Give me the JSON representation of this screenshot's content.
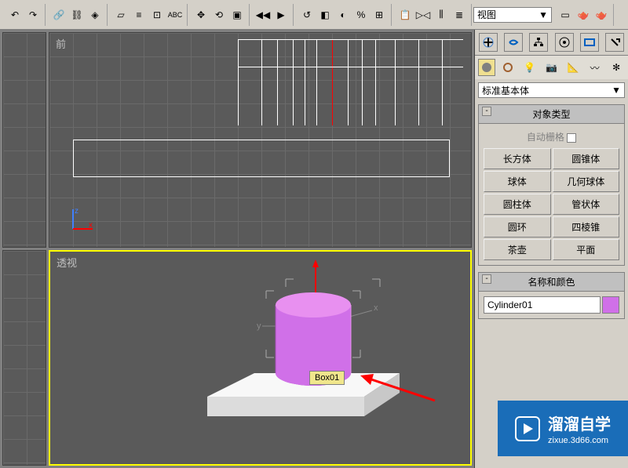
{
  "toolbar": {
    "view_dropdown": "视图"
  },
  "viewports": {
    "front_label": "前",
    "perspective_label": "透视",
    "axis_z": "z",
    "axis_x": "x",
    "axis_y": "y",
    "object_tooltip": "Box01"
  },
  "panel": {
    "category_dropdown": "标准基本体",
    "object_type_header": "对象类型",
    "autogrid_label": "自动栅格",
    "buttons": {
      "box": "长方体",
      "cone": "圆锥体",
      "sphere": "球体",
      "geosphere": "几何球体",
      "cylinder": "圆柱体",
      "tube": "管状体",
      "torus": "圆环",
      "pyramid": "四棱锥",
      "teapot": "茶壶",
      "plane": "平面"
    },
    "name_color_header": "名称和颜色",
    "object_name": "Cylinder01"
  },
  "watermark": {
    "text": "溜溜自学",
    "url": "zixue.3d66.com"
  }
}
